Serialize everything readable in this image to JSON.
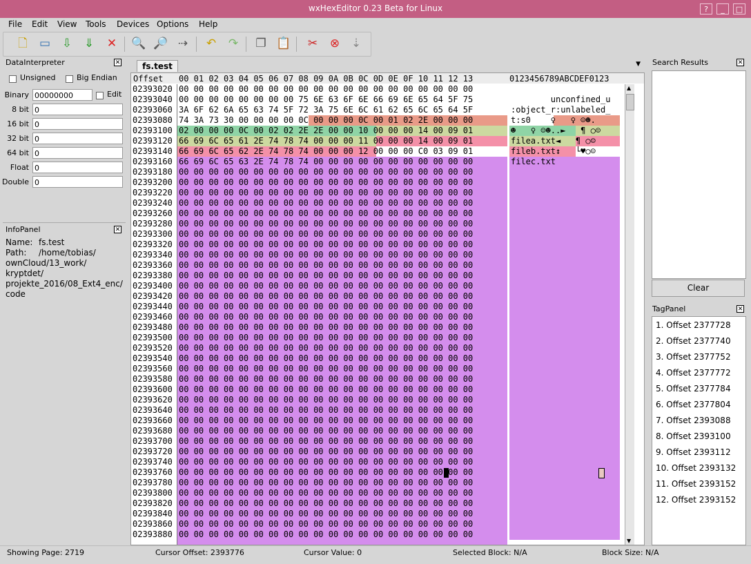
{
  "window": {
    "title": "wxHexEditor 0.23 Beta for Linux"
  },
  "menu": {
    "file": "File",
    "edit": "Edit",
    "view": "View",
    "tools": "Tools",
    "devices": "Devices",
    "options": "Options",
    "help": "Help"
  },
  "data_interpreter": {
    "title": "DataInterpreter",
    "unsigned_label": "Unsigned",
    "big_endian_label": "Big Endian",
    "edit_label": "Edit",
    "binary_label": "Binary",
    "binary_value": "00000000",
    "bit8_label": "8 bit",
    "bit8_value": "0",
    "bit16_label": "16 bit",
    "bit16_value": "0",
    "bit32_label": "32 bit",
    "bit32_value": "0",
    "bit64_label": "64 bit",
    "bit64_value": "0",
    "float_label": "Float",
    "float_value": "0",
    "double_label": "Double",
    "double_value": "0"
  },
  "info_panel": {
    "title": "InfoPanel",
    "name_label": "Name:",
    "name_value": "fs.test",
    "path_label": "Path:",
    "path_lines": [
      "/home/tobias/",
      "ownCloud/13_work/",
      "kryptdet/",
      "projekte_2016/08_Ext4_enc/",
      "code"
    ]
  },
  "editor": {
    "tab": "fs.test",
    "header_offset": "Offset",
    "header_bytes": "00 01 02 03 04 05 06 07 08 09 0A 0B 0C 0D 0E 0F 10 11 12 13",
    "header_ascii": "0123456789ABCDEF0123",
    "offsets": [
      "02393020",
      "02393040",
      "02393060",
      "02393080",
      "02393100",
      "02393120",
      "02393140",
      "02393160",
      "02393180",
      "02393200",
      "02393220",
      "02393240",
      "02393260",
      "02393280",
      "02393300",
      "02393320",
      "02393340",
      "02393360",
      "02393380",
      "02393400",
      "02393420",
      "02393440",
      "02393460",
      "02393480",
      "02393500",
      "02393520",
      "02393540",
      "02393560",
      "02393580",
      "02393600",
      "02393620",
      "02393640",
      "02393660",
      "02393680",
      "02393700",
      "02393720",
      "02393740",
      "02393760",
      "02393780",
      "02393800",
      "02393820",
      "02393840",
      "02393860",
      "02393880"
    ],
    "special_rows": [
      "00 00 00 00 00 00 00 00 00 00 00 00 00 00 00 00 00 00 00 00",
      "00 00 00 00 00 00 00 00 75 6E 63 6F 6E 66 69 6E 65 64 5F 75",
      "3A 6F 62 6A 65 63 74 5F 72 3A 75 6E 6C 61 62 65 6C 65 64 5F",
      "74 3A 73 30 00 00 00 00 0C 00 00 00 0C 00 01 02 2E 00 00 00",
      "02 00 00 00 0C 00 02 02 2E 2E 00 00 10 00 00 00 14 00 09 01",
      "66 69 6C 65 61 2E 74 78 74 00 00 00 11 00 00 00 14 00 09 01",
      "66 69 6C 65 62 2E 74 78 74 00 00 00 12 00 00 00 C0 03 09 01",
      "66 69 6C 65 63 2E 74 78 74 00 00 00 00 00 00 00 00 00 00 00"
    ],
    "zero_row": "00 00 00 00 00 00 00 00 00 00 00 00 00 00 00 00 00 00 00 00",
    "ascii_rows": [
      "",
      "        unconfined_u",
      ":object_r:unlabeled_",
      "t:s0    ♀   ♀ ☺☻.",
      "☻   ♀ ☺☻..►   ¶ ○☺",
      "filea.txt◄   ¶ ○☺",
      "fileb.txt↕   └♥○☺",
      "filec.txt"
    ]
  },
  "search_results": {
    "title": "Search Results",
    "clear_button": "Clear"
  },
  "tag_panel": {
    "title": "TagPanel",
    "items": [
      "1. Offset 2377728",
      "2. Offset 2377740",
      "3. Offset 2377752",
      "4. Offset 2377772",
      "5. Offset 2377784",
      "6. Offset 2377804",
      "7. Offset 2393088",
      "8. Offset 2393100",
      "9. Offset 2393112",
      "10. Offset 2393132",
      "11. Offset 2393152",
      "12. Offset 2393152"
    ]
  },
  "status": {
    "page": "Showing Page: 2719",
    "cursor_offset": "Cursor Offset: 2393776",
    "cursor_value": "Cursor Value: 0",
    "selected_block": "Selected Block: N/A",
    "block_size": "Block Size: N/A"
  },
  "colors": {
    "title": "#c35e83",
    "purple": "#d48ded",
    "orange": "#e99a88",
    "green": "#8fd4a6",
    "yellow": "#ccd9a0",
    "pink": "#f490a8"
  }
}
